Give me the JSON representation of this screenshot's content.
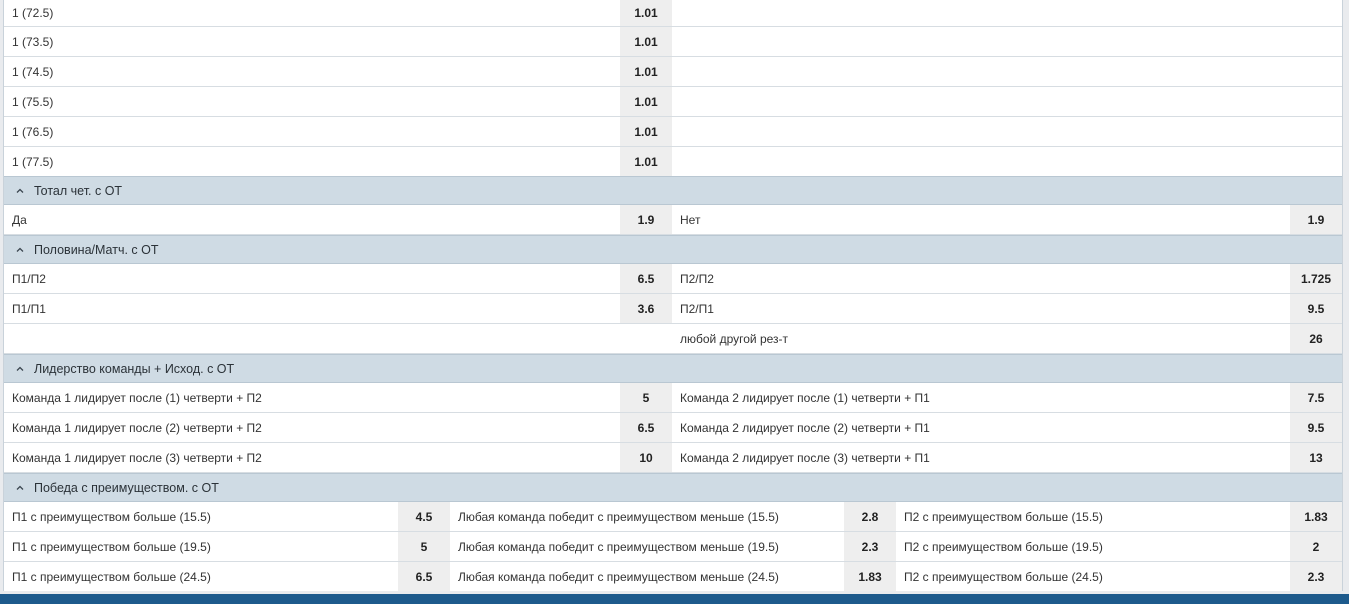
{
  "top_rows": [
    {
      "label": "1 (72.5)",
      "odds": "1.01"
    },
    {
      "label": "1 (73.5)",
      "odds": "1.01"
    },
    {
      "label": "1 (74.5)",
      "odds": "1.01"
    },
    {
      "label": "1 (75.5)",
      "odds": "1.01"
    },
    {
      "label": "1 (76.5)",
      "odds": "1.01"
    },
    {
      "label": "1 (77.5)",
      "odds": "1.01"
    }
  ],
  "section_total": {
    "title": "Тотал чет. с ОТ",
    "rows": [
      {
        "left_label": "Да",
        "left_odds": "1.9",
        "right_label": "Нет",
        "right_odds": "1.9"
      }
    ]
  },
  "section_halfmatch": {
    "title": "Половина/Матч. с ОТ",
    "rows": [
      {
        "left_label": "П1/П2",
        "left_odds": "6.5",
        "right_label": "П2/П2",
        "right_odds": "1.725"
      },
      {
        "left_label": "П1/П1",
        "left_odds": "3.6",
        "right_label": "П2/П1",
        "right_odds": "9.5"
      },
      {
        "left_label": "",
        "left_odds": "",
        "right_label": "любой другой рез-т",
        "right_odds": "26"
      }
    ]
  },
  "section_lead": {
    "title": "Лидерство команды + Исход. с ОТ",
    "rows": [
      {
        "left_label": "Команда 1 лидирует после (1) четверти + П2",
        "left_odds": "5",
        "right_label": "Команда 2 лидирует после (1) четверти + П1",
        "right_odds": "7.5"
      },
      {
        "left_label": "Команда 1 лидирует после (2) четверти + П2",
        "left_odds": "6.5",
        "right_label": "Команда 2 лидирует после (2) четверти + П1",
        "right_odds": "9.5"
      },
      {
        "left_label": "Команда 1 лидирует после (3) четверти + П2",
        "left_odds": "10",
        "right_label": "Команда 2 лидирует после (3) четверти + П1",
        "right_odds": "13"
      }
    ]
  },
  "section_margin": {
    "title": "Победа с преимуществом. с ОТ",
    "rows": [
      {
        "a_label": "П1 с преимуществом больше (15.5)",
        "a_odds": "4.5",
        "b_label": "Любая команда победит с преимуществом меньше (15.5)",
        "b_odds": "2.8",
        "c_label": "П2 с преимуществом больше (15.5)",
        "c_odds": "1.83"
      },
      {
        "a_label": "П1 с преимуществом больше (19.5)",
        "a_odds": "5",
        "b_label": "Любая команда победит с преимуществом меньше (19.5)",
        "b_odds": "2.3",
        "c_label": "П2 с преимуществом больше (19.5)",
        "c_odds": "2"
      },
      {
        "a_label": "П1 с преимуществом больше (24.5)",
        "a_odds": "6.5",
        "b_label": "Любая команда победит с преимуществом меньше (24.5)",
        "b_odds": "1.83",
        "c_label": "П2 с преимуществом больше (24.5)",
        "c_odds": "2.3"
      }
    ]
  },
  "colors": {
    "section_bg": "#cfdbe4",
    "odds_bg": "#eeeeee",
    "bottom_bar": "#1d5a8c"
  },
  "icons": {
    "section_toggle": "chevron-up-icon"
  }
}
